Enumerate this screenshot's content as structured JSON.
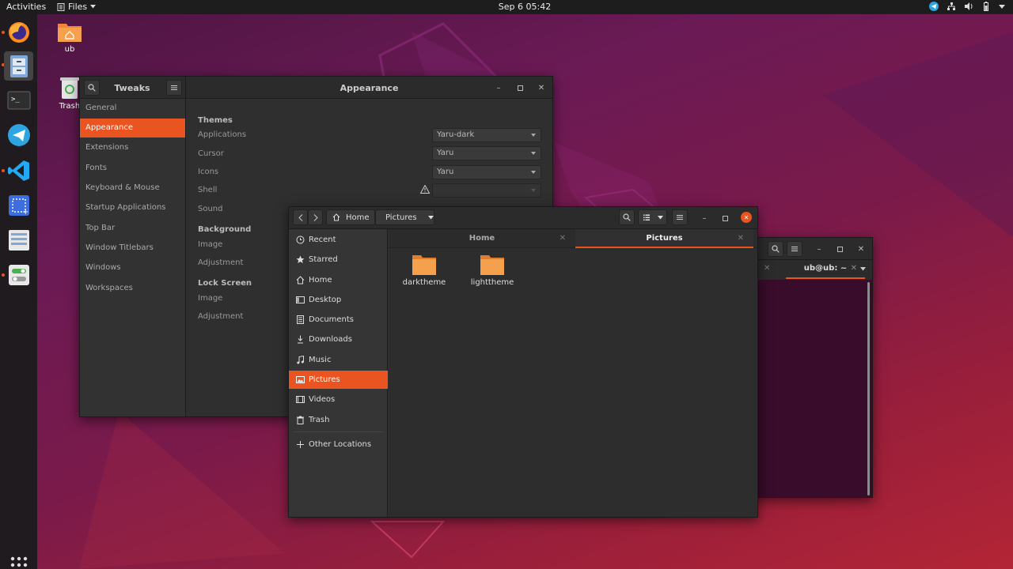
{
  "topbar": {
    "activities": "Activities",
    "app_menu": "Files",
    "clock": "Sep 6  05:42"
  },
  "desktop": {
    "icons": [
      {
        "label": "ub"
      },
      {
        "label": "Trash"
      }
    ]
  },
  "tweaks": {
    "sidebar_title": "Tweaks",
    "main_title": "Appearance",
    "sidebar_items": [
      "General",
      "Appearance",
      "Extensions",
      "Fonts",
      "Keyboard & Mouse",
      "Startup Applications",
      "Top Bar",
      "Window Titlebars",
      "Windows",
      "Workspaces"
    ],
    "selected_index": 1,
    "themes": {
      "heading": "Themes",
      "applications_label": "Applications",
      "applications_value": "Yaru-dark",
      "cursor_label": "Cursor",
      "cursor_value": "Yaru",
      "icons_label": "Icons",
      "icons_value": "Yaru",
      "shell_label": "Shell",
      "sound_label": "Sound"
    },
    "background": {
      "heading": "Background",
      "image_label": "Image",
      "adjustment_label": "Adjustment"
    },
    "lock_screen": {
      "heading": "Lock Screen",
      "image_label": "Image",
      "adjustment_label": "Adjustment"
    }
  },
  "files": {
    "path": [
      "Home",
      "Pictures"
    ],
    "sidebar": [
      "Recent",
      "Starred",
      "Home",
      "Desktop",
      "Documents",
      "Downloads",
      "Music",
      "Pictures",
      "Videos",
      "Trash"
    ],
    "other_locations": "Other Locations",
    "selected_index": 7,
    "tabs": [
      {
        "label": "Home",
        "active": false
      },
      {
        "label": "Pictures",
        "active": true
      }
    ],
    "folders": [
      "darktheme",
      "lighttheme"
    ]
  },
  "terminal": {
    "tab_label": "ub@ub: ~"
  },
  "colors": {
    "accent": "#e95420",
    "folder": "#f5a04c",
    "terminal_bg": "#380c2a"
  }
}
